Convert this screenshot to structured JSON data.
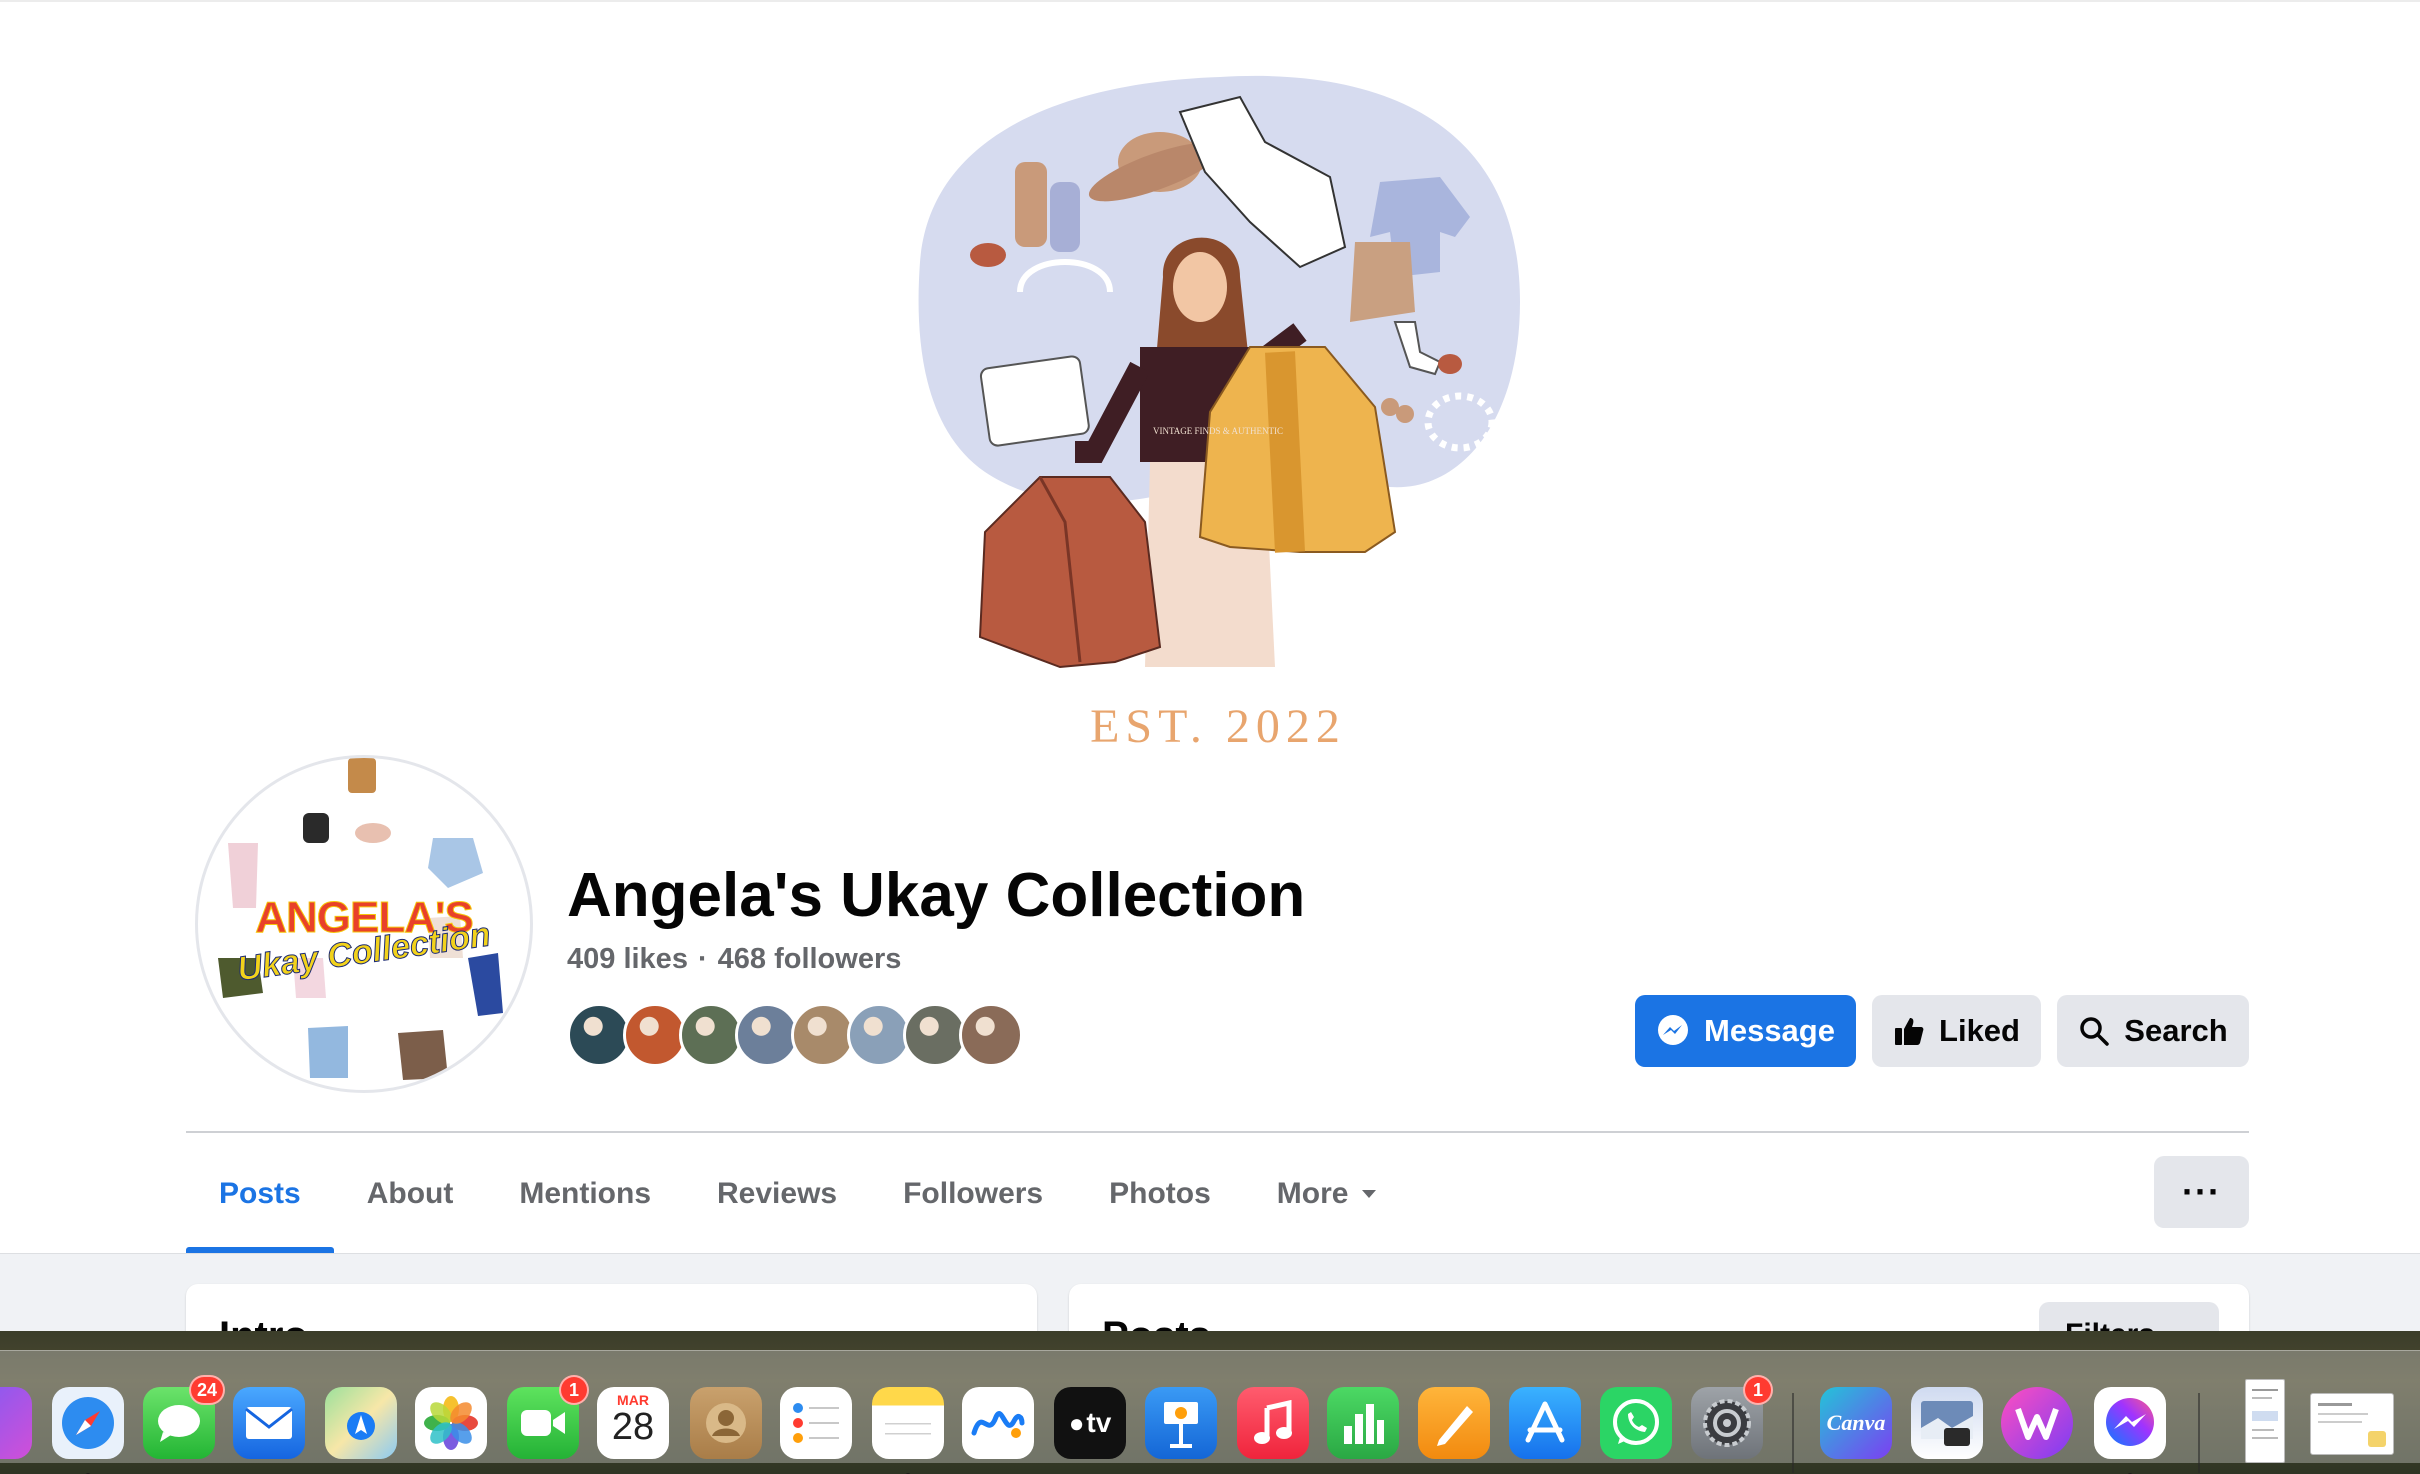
{
  "cover": {
    "established": "EST. 2022",
    "shirt_print": "VINTAGE FINDS & AUTHENTIC"
  },
  "profile": {
    "logo_main": "ANGELA'S",
    "logo_sub": "Ukay Collection",
    "name": "Angela's Ukay Collection",
    "likes": "409 likes",
    "separator": "·",
    "followers": "468 followers",
    "friend_avatars": [
      {
        "color": "#2c4a56"
      },
      {
        "color": "#c2582f"
      },
      {
        "color": "#5d6f55"
      },
      {
        "color": "#6c7f9a"
      },
      {
        "color": "#a88a6a"
      },
      {
        "color": "#8aa0b8"
      },
      {
        "color": "#6a6e62"
      },
      {
        "color": "#8a6b58"
      }
    ]
  },
  "actions": {
    "message": "Message",
    "liked": "Liked",
    "search": "Search"
  },
  "tabs": [
    {
      "label": "Posts",
      "active": true
    },
    {
      "label": "About"
    },
    {
      "label": "Mentions"
    },
    {
      "label": "Reviews"
    },
    {
      "label": "Followers"
    },
    {
      "label": "Photos"
    },
    {
      "label": "More"
    }
  ],
  "more_menu": "···",
  "feed": {
    "left_title": "Intro",
    "right_title": "Posts",
    "filter": "Filters"
  },
  "dock": {
    "calendar_month": "MAR",
    "calendar_day": "28",
    "tv_label": "tv",
    "canva_label": "Canva",
    "messages_badge": "24",
    "facetime_badge": "1",
    "settings_badge": "1"
  },
  "colors": {
    "accent": "#1b74e4",
    "secondary_button": "#e4e6eb",
    "muted_text": "#65676b",
    "cover_blob": "#d6dbef",
    "est_text": "#e8a56e"
  }
}
